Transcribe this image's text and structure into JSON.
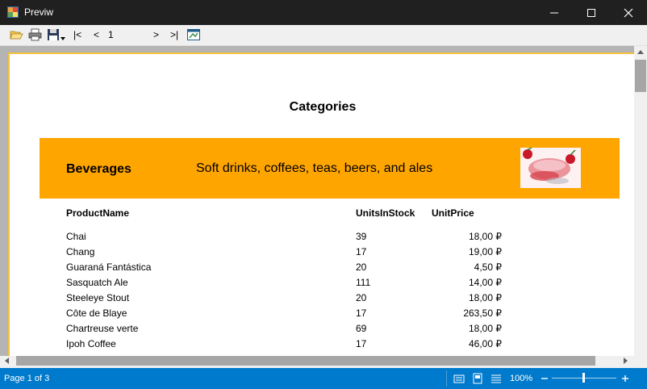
{
  "window": {
    "title": "Previw"
  },
  "toolbar": {
    "first_label": "|<",
    "prev_label": "<",
    "page_value": "1",
    "next_label": ">",
    "last_label": ">|"
  },
  "report": {
    "title": "Categories",
    "category": {
      "name": "Beverages",
      "description": "Soft drinks, coffees, teas, beers, and ales"
    },
    "columns": [
      "ProductName",
      "UnitsInStock",
      "UnitPrice"
    ],
    "rows": [
      [
        "Chai",
        "39",
        "18,00 ₽"
      ],
      [
        "Chang",
        "17",
        "19,00 ₽"
      ],
      [
        "Guaraná Fantástica",
        "20",
        "4,50 ₽"
      ],
      [
        "Sasquatch Ale",
        "111",
        "14,00 ₽"
      ],
      [
        "Steeleye Stout",
        "20",
        "18,00 ₽"
      ],
      [
        "Côte de Blaye",
        "17",
        "263,50 ₽"
      ],
      [
        "Chartreuse verte",
        "69",
        "18,00 ₽"
      ],
      [
        "Ipoh Coffee",
        "17",
        "46,00 ₽"
      ]
    ]
  },
  "status": {
    "page_info": "Page 1 of 3",
    "zoom": "100%"
  },
  "colors": {
    "titlebar": "#202020",
    "category_band": "#ffa500",
    "statusbar": "#007acc",
    "page_border": "#f5c23c"
  },
  "icons": [
    "app-icon",
    "minimize-icon",
    "maximize-icon",
    "close-icon",
    "open-folder-icon",
    "print-icon",
    "save-icon",
    "dropdown-arrow-icon",
    "export-icon",
    "single-page-icon",
    "multi-page-icon",
    "continuous-icon",
    "zoom-out-icon",
    "zoom-in-icon"
  ]
}
